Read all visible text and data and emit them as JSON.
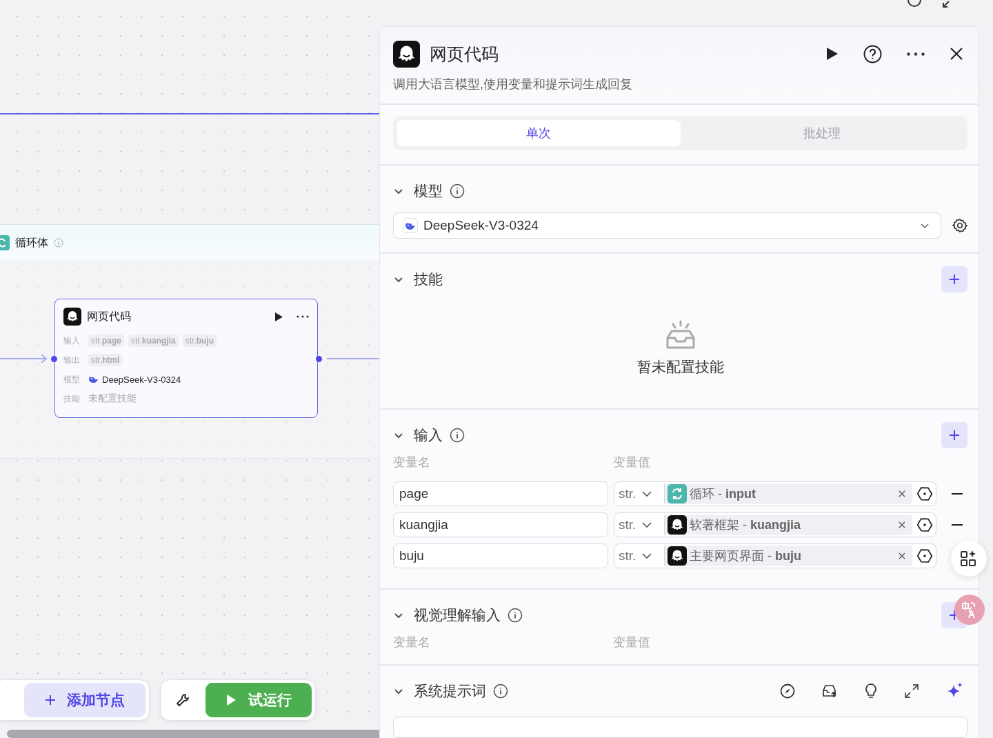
{
  "canvas": {
    "loop_title": "循环体",
    "node": {
      "title": "网页代码",
      "rows": [
        {
          "label": "输入",
          "kind": "tags",
          "tags": [
            "str.**page**",
            "str.**kuangjia**",
            "str.**buju**"
          ]
        },
        {
          "label": "输出",
          "kind": "tags",
          "tags": [
            "str.**html**"
          ]
        },
        {
          "label": "模型",
          "kind": "model",
          "value": "DeepSeek-V3-0324"
        },
        {
          "label": "技能",
          "kind": "empty",
          "value": "未配置技能"
        }
      ]
    }
  },
  "toolbar": {
    "add_node": "添加节点",
    "test_run": "试运行"
  },
  "panel": {
    "title": "网页代码",
    "description": "调用大语言模型,使用变量和提示词生成回复",
    "tabs": [
      {
        "label": "单次",
        "selected": true
      },
      {
        "label": "批处理",
        "selected": false
      }
    ],
    "sections": [
      {
        "kind": "model",
        "title": "模型",
        "expanded": true,
        "info": true,
        "model": "DeepSeek-V3-0324"
      },
      {
        "kind": "skills",
        "title": "技能",
        "expanded": true,
        "info": false,
        "empty_text": "暂未配置技能"
      },
      {
        "kind": "inputs",
        "title": "输入",
        "expanded": true,
        "info": true,
        "col_name": "变量名",
        "col_value": "变量值",
        "rows": [
          {
            "name": "page",
            "type": "str.",
            "kind": "loop",
            "ref": "循环 - **input**",
            "removable": true
          },
          {
            "name": "kuangjia",
            "type": "str.",
            "kind": "bot",
            "ref": "软著框架 - **kuangjia**",
            "removable": true
          },
          {
            "name": "buju",
            "type": "str.",
            "kind": "bot",
            "ref": "主要网页界面 - **buju**",
            "removable": false
          }
        ]
      },
      {
        "kind": "vision",
        "title": "视觉理解输入",
        "expanded": true,
        "info": true,
        "col_name": "变量名",
        "col_value": "变量值"
      },
      {
        "kind": "prompt",
        "title": "系统提示词",
        "expanded": true,
        "info": true
      }
    ]
  }
}
